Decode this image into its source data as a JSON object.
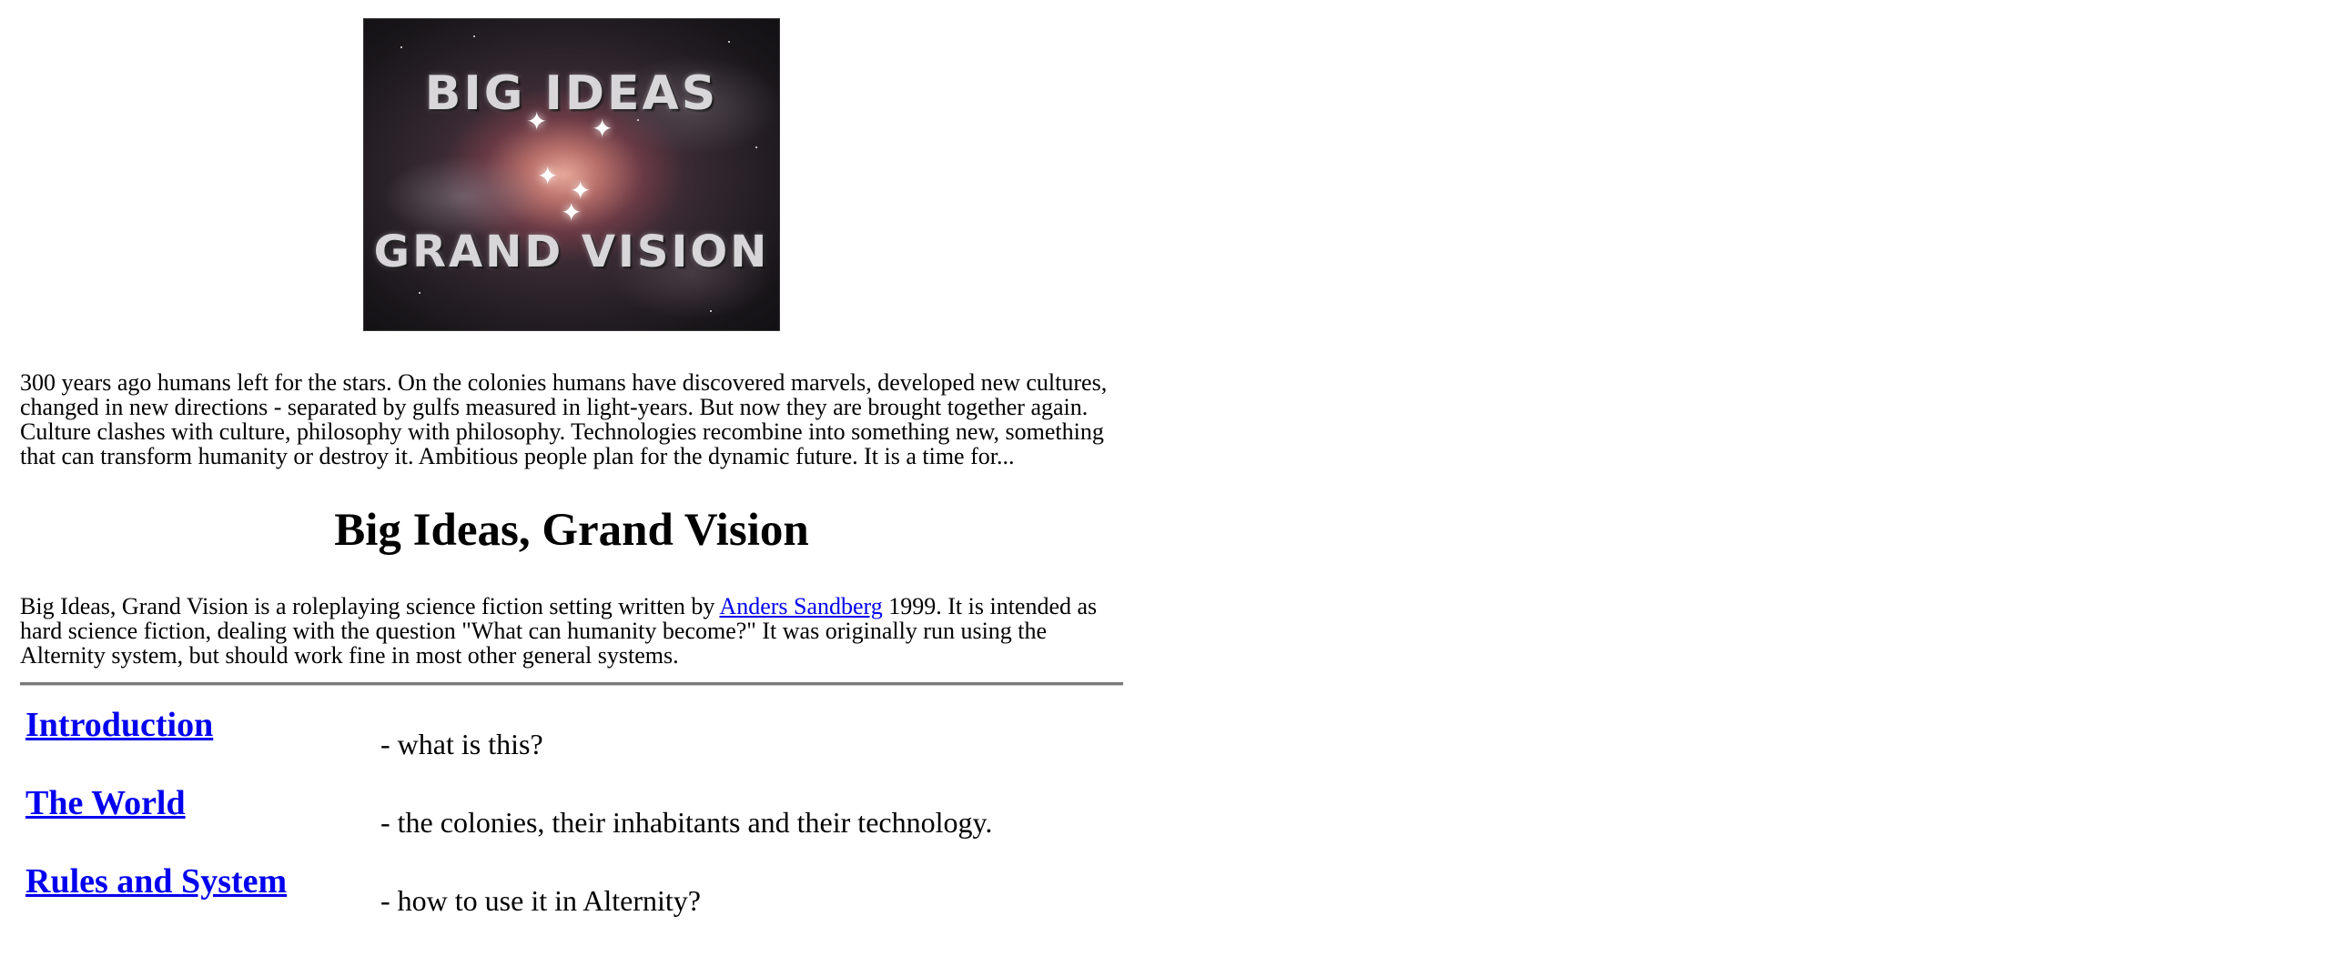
{
  "logo": {
    "line1": "BIG IDEAS",
    "line2": "GRAND VISION",
    "icon": "nebula-logo-image"
  },
  "intro_paragraph": "300 years ago humans left for the stars. On the colonies humans have discovered marvels, developed new cultures, changed in new directions - separated by gulfs measured in light-years. But now they are brought together again. Culture clashes with culture, philosophy with philosophy. Technologies recombine into something new, something that can transform humanity or destroy it. Ambitious people plan for the dynamic future. It is a time for...",
  "heading": "Big Ideas, Grand Vision",
  "description": {
    "before_link": "Big Ideas, Grand Vision is a roleplaying science fiction setting written by ",
    "author_link": "Anders Sandberg",
    "after_link": " 1999. It is intended as hard science fiction, dealing with the question \"What can humanity become?\" It was originally run using the Alternity system, but should work fine in most other general systems."
  },
  "toc": [
    {
      "label": "Introduction",
      "desc": "- what is this?"
    },
    {
      "label": "The World",
      "desc": "- the colonies, their inhabitants and their technology."
    },
    {
      "label": "Rules and System",
      "desc": "- how to use it in Alternity?"
    }
  ],
  "colors": {
    "link": "#0000ee",
    "text": "#000000",
    "divider": "#7a7a7a"
  }
}
